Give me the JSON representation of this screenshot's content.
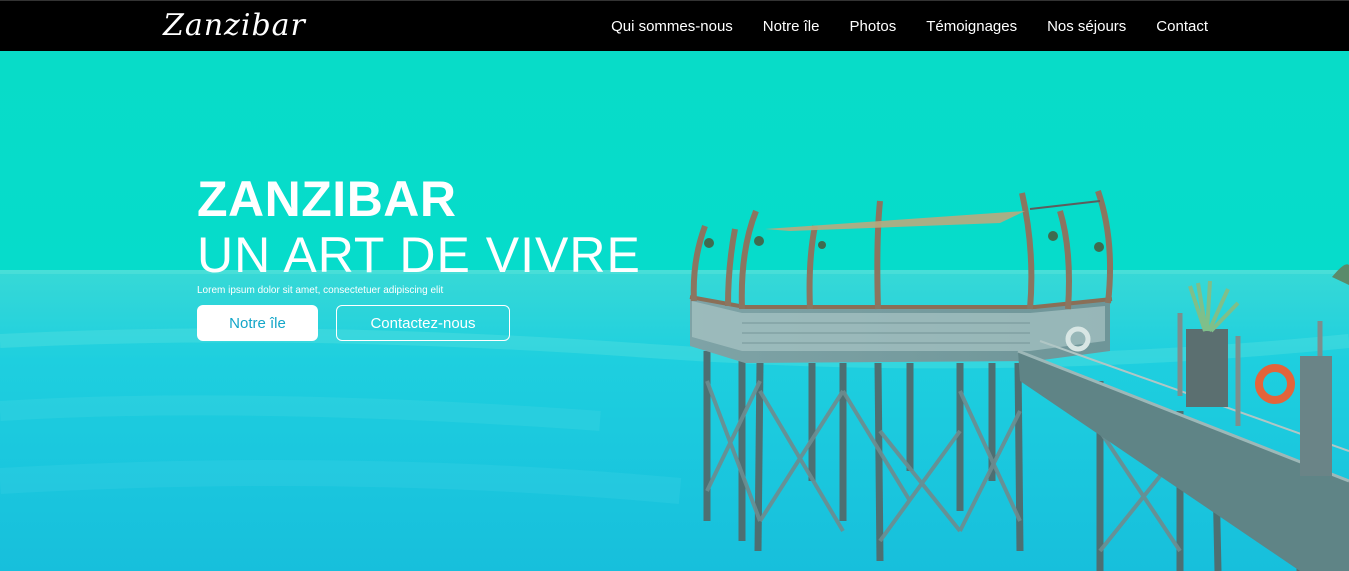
{
  "brand": {
    "logo": "Zanzibar"
  },
  "nav": {
    "items": [
      {
        "label": "Qui sommes-nous"
      },
      {
        "label": "Notre île"
      },
      {
        "label": "Photos"
      },
      {
        "label": "Témoignages"
      },
      {
        "label": "Nos séjours"
      },
      {
        "label": "Contact"
      }
    ]
  },
  "hero": {
    "title": "ZANZIBAR",
    "subtitle": "UN ART DE VIVRE",
    "text": "Lorem ipsum dolor sit amet, consectetuer adipiscing elit",
    "primary_button": "Notre île",
    "secondary_button": "Contactez-nous",
    "background": "ocean-pier-photo"
  },
  "colors": {
    "nav_bg": "#000000",
    "hero_tint": "#08dcc8",
    "button_text": "#12a6c8"
  }
}
